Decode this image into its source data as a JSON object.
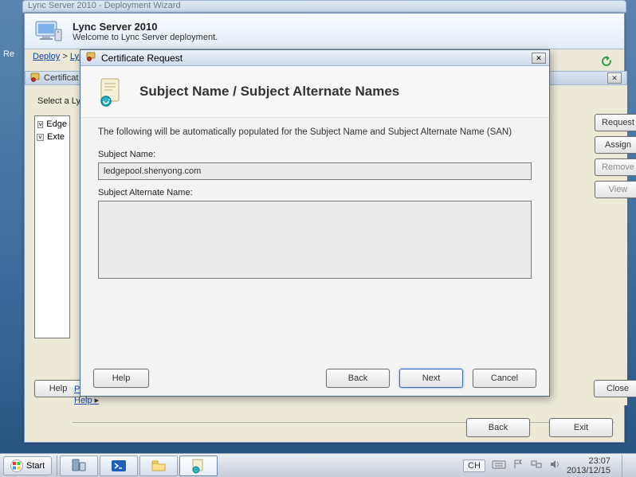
{
  "parent_title": "Lync Server 2010 - Deployment Wizard",
  "left_margin_label": "Re",
  "deploy": {
    "title": "Lync Server 2010",
    "subtitle": "Welcome to Lync Server deployment."
  },
  "breadcrumb": {
    "item1": "Deploy",
    "sep": ">",
    "item2": "Lyn"
  },
  "cert_window": {
    "title": "Certificat",
    "prompt": "Select a Lyn",
    "tree": {
      "row1": "Edge",
      "row2": "Exte"
    }
  },
  "right_buttons": {
    "request": "Request",
    "assign": "Assign",
    "remove": "Remove",
    "view": "View"
  },
  "footer": {
    "help": "Help",
    "close": "Close",
    "pre": "Pre",
    "help_line": "Help"
  },
  "deploy_bottom": {
    "back": "Back",
    "exit": "Exit"
  },
  "modal": {
    "title": "Certificate Request",
    "heading": "Subject Name / Subject Alternate Names",
    "info": "The following will be automatically populated for the Subject Name and Subject Alternate Name (SAN)",
    "subject_name_label": "Subject Name:",
    "subject_name_value": "ledgepool.shenyong.com",
    "san_label": "Subject Alternate Name:",
    "help": "Help",
    "back": "Back",
    "next": "Next",
    "cancel": "Cancel"
  },
  "taskbar": {
    "start": "Start",
    "ime": "CH",
    "time": "23:07",
    "date": "2013/12/15"
  }
}
